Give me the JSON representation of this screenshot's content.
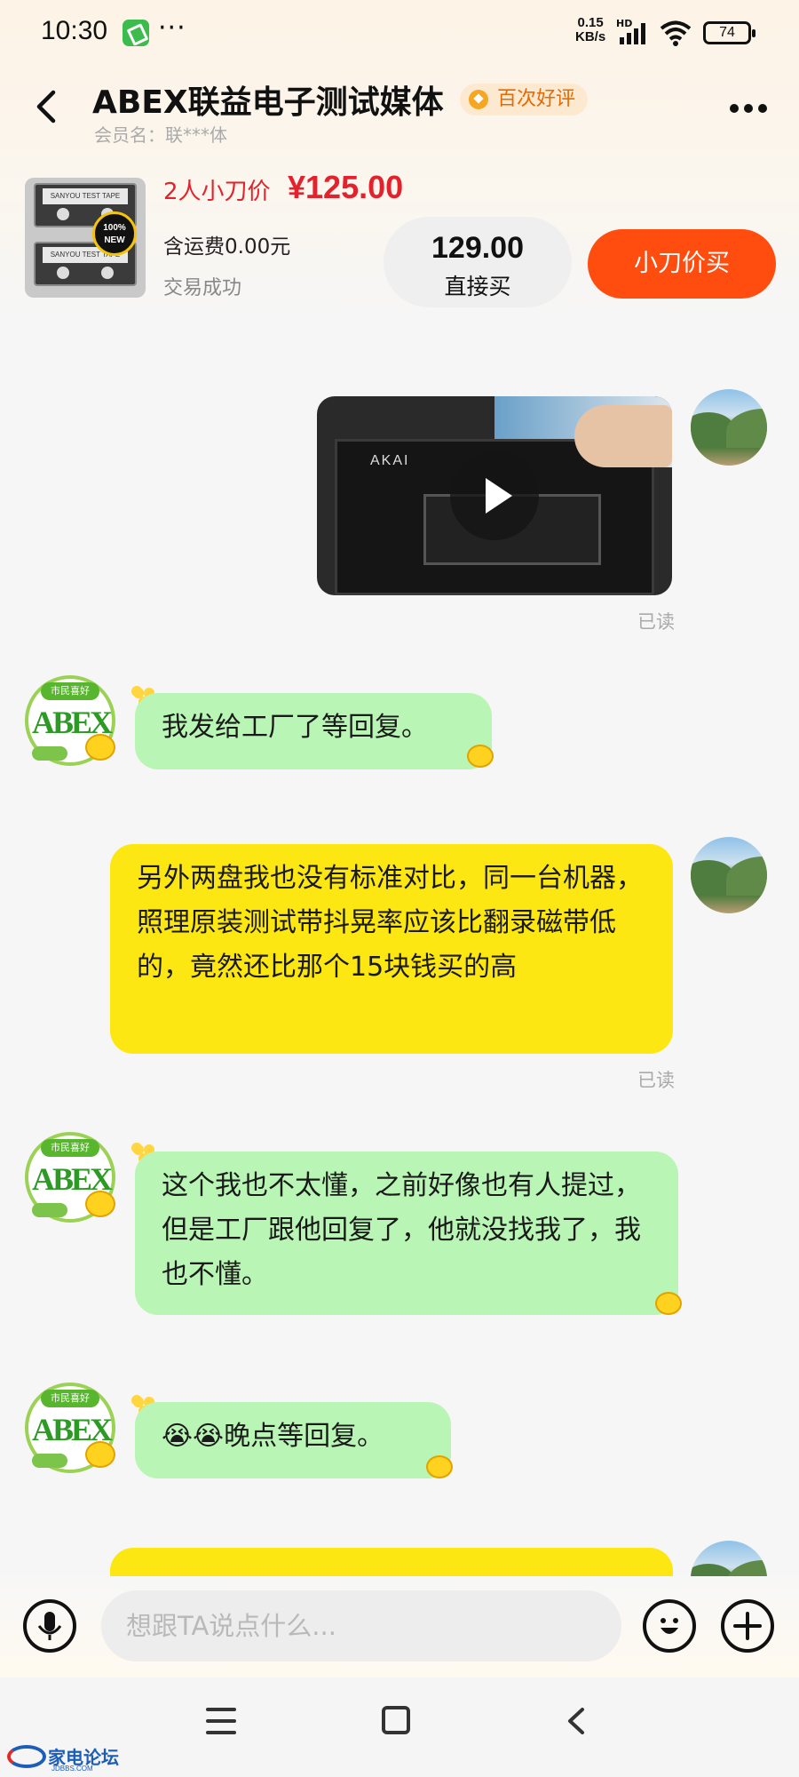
{
  "status_bar": {
    "time": "10:30",
    "more": "···",
    "net_speed_value": "0.15",
    "net_speed_unit": "KB/s",
    "hd": "HD",
    "battery": "74"
  },
  "header": {
    "title": "ABEX联益电子测试媒体",
    "badge": "百次好评",
    "member": "会员名：联***体",
    "back_icon": "chevron-left-icon",
    "more_icon": "more-dots-icon"
  },
  "product": {
    "offer_text": "2人小刀价",
    "offer_price": "¥125.00",
    "shipping": "含运费0.00元",
    "status": "交易成功",
    "direct_price": "129.00",
    "direct_label": "直接买",
    "cut_label": "小刀价买",
    "image_badge": "100% NEW",
    "tape_label": "SANYOU TEST TAPE"
  },
  "messages": [
    {
      "from": "me",
      "type": "video",
      "read": "已读",
      "video_brand": "AKAI"
    },
    {
      "from": "shop",
      "type": "text",
      "text": "我发给工厂了等回复。"
    },
    {
      "from": "me",
      "type": "text",
      "text": "另外两盘我也没有标准对比，同一台机器，照理原装测试带抖晃率应该比翻录磁带低的，竟然还比那个15块钱买的高",
      "read": "已读"
    },
    {
      "from": "shop",
      "type": "text",
      "text": "这个我也不太懂，之前好像也有人提过，但是工厂跟他回复了，他就没找我了，我也不懂。"
    },
    {
      "from": "shop",
      "type": "text",
      "text": "😭😭晚点等回复。"
    }
  ],
  "shop_avatar": {
    "top_text": "市民喜好",
    "logo": "ABEX"
  },
  "input": {
    "placeholder": "想跟TA说点什么..."
  },
  "watermark": {
    "text": "家电论坛",
    "sub": "JDBBS.COM"
  },
  "colors": {
    "accent": "#ff4c0f",
    "price_red": "#e2232d",
    "bubble_green": "#b9f5b4",
    "bubble_yellow": "#fde712"
  }
}
